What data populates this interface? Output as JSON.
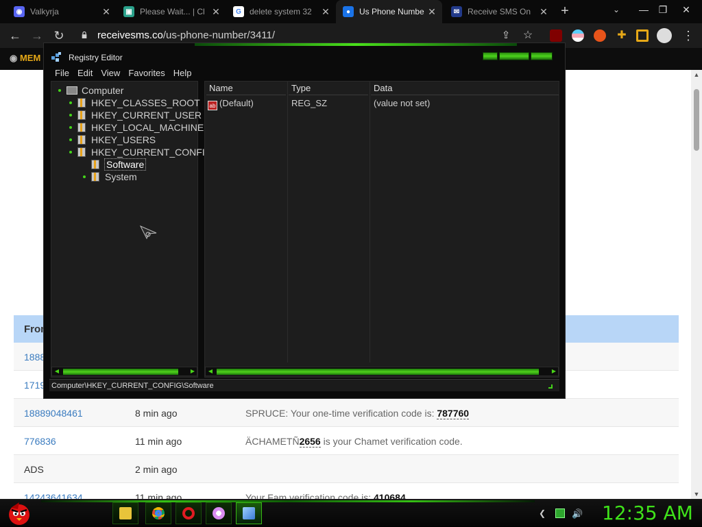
{
  "browser": {
    "tabs": [
      {
        "title": "Valkyrja",
        "favicon": "discord-icon",
        "active": false
      },
      {
        "title": "Please Wait... | Cl",
        "favicon": "cloudflare-icon",
        "active": false
      },
      {
        "title": "delete system 32",
        "favicon": "google-icon",
        "active": false
      },
      {
        "title": "Us Phone Numbe",
        "favicon": "chat-icon",
        "active": true
      },
      {
        "title": "Receive SMS On",
        "favicon": "envelope-icon",
        "active": false
      }
    ],
    "new_tab": "+",
    "tab_menu": "⌄",
    "window_controls": [
      "—",
      "❐",
      "✕"
    ],
    "url_host": "receivesms.co",
    "url_path": "/us-phone-number/3411/",
    "site_menu_label": "MEM"
  },
  "sms_table": {
    "header_from": "From",
    "rows": [
      {
        "from": "1888",
        "time": "",
        "message": "",
        "code": ""
      },
      {
        "from": "1719",
        "time": "",
        "message": "",
        "code": ""
      },
      {
        "from": "18889048461",
        "time": "8 min ago",
        "message": "SPRUCE: Your one-time verification code is: ",
        "code": "787760",
        "suffix": ""
      },
      {
        "from": "776836",
        "time": "11 min ago",
        "message": "ÄCHAMETÑ",
        "code": "2656",
        "suffix": " is your Chamet verification code."
      },
      {
        "from": "ADS",
        "time": "2 min ago",
        "message": "",
        "code": "",
        "suffix": ""
      },
      {
        "from": "14243641634",
        "time": "11 min ago",
        "message": "Your Fam verification code is: ",
        "code": "410684",
        "suffix": ""
      }
    ]
  },
  "regedit": {
    "title": "Registry Editor",
    "menu": [
      "File",
      "Edit",
      "View",
      "Favorites",
      "Help"
    ],
    "tree": {
      "root": "Computer",
      "hives": [
        "HKEY_CLASSES_ROOT",
        "HKEY_CURRENT_USER",
        "HKEY_LOCAL_MACHINE",
        "HKEY_USERS",
        "HKEY_CURRENT_CONFI"
      ],
      "children": [
        "Software",
        "System"
      ],
      "selected": "Software"
    },
    "columns": [
      "Name",
      "Type",
      "Data"
    ],
    "values": [
      {
        "name": "(Default)",
        "type": "REG_SZ",
        "data": "(value not set)"
      }
    ],
    "status_path": "Computer\\HKEY_CURRENT_CONFIG\\Software"
  },
  "taskbar": {
    "clock": "12:35 AM",
    "pinned": [
      "explorer-icon",
      "chrome-icon",
      "opera-icon",
      "circle-app-icon",
      "regedit-icon"
    ]
  }
}
